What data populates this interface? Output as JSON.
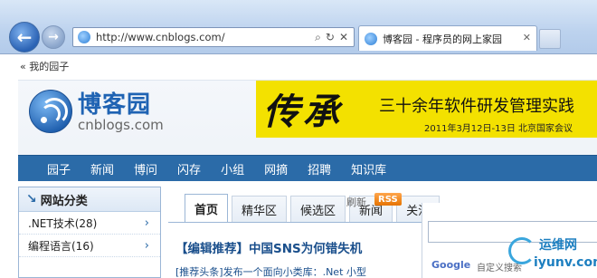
{
  "browser": {
    "address": "http://www.cnblogs.com/",
    "tab_title": "博客园 - 程序员的网上家园",
    "back_glyph": "←",
    "forward_glyph": "→",
    "address_icons": [
      "search-icon",
      "refresh-icon",
      "stop-icon"
    ],
    "address_glyphs": [
      "⌕",
      "↻",
      "✕"
    ],
    "tab_close_glyph": "✕"
  },
  "page": {
    "breadcrumb": "« 我的园子",
    "logo": {
      "name": "博客园",
      "domain": "cnblogs.com"
    },
    "banner": {
      "calligraphy": "传承",
      "title": "三十余年软件研发管理实践",
      "date": "2011年3月12日-13日  北京国家会议"
    },
    "nav": [
      "园子",
      "新闻",
      "博问",
      "闪存",
      "小组",
      "网摘",
      "招聘",
      "知识库"
    ],
    "sidebar": {
      "title": "网站分类",
      "items": [
        {
          "label": ".NET技术(28)",
          "chevron": "›"
        },
        {
          "label": "编程语言(16)",
          "chevron": "›"
        }
      ]
    },
    "content_tabs": [
      "首页",
      "精华区",
      "候选区",
      "新闻",
      "关注"
    ],
    "refresh_label": "刷新",
    "rss_label": "RSS",
    "headline": "【编辑推荐】中国SNS为何错失机",
    "subline": "[推荐头条]发布一个面向小类库：.Net 小型",
    "search": {
      "google_label": "Google",
      "custom_label": "自定义搜索"
    }
  },
  "watermark": {
    "cn": "运维网",
    "url": "iyunv.com"
  },
  "colors": {
    "nav_bg": "#2b6ba8",
    "banner_bg": "#f3e100",
    "logo_blue": "#1f63b3"
  }
}
